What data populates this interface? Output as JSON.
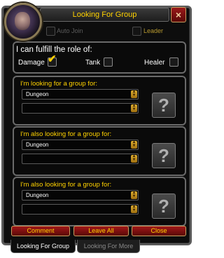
{
  "window": {
    "title": "Looking For Group",
    "close_symbol": "×"
  },
  "options": {
    "auto_join_label": "Auto Join",
    "leader_label": "Leader"
  },
  "roles": {
    "title": "I can fulfill the role of:",
    "damage_label": "Damage",
    "damage_checked": true,
    "tank_label": "Tank",
    "healer_label": "Healer"
  },
  "groups": [
    {
      "label": "I'm looking for a group for:",
      "type_value": "Dungeon",
      "subtype_value": ""
    },
    {
      "label": "I'm also looking for a group for:",
      "type_value": "Dungeon",
      "subtype_value": ""
    },
    {
      "label": "I'm also looking for a group for:",
      "type_value": "Dungeon",
      "subtype_value": ""
    }
  ],
  "question_mark": "?",
  "buttons": {
    "comment": "Comment",
    "leave_all": "Leave All",
    "close": "Close"
  },
  "tabs": [
    {
      "label": "Looking For Group"
    },
    {
      "label": "Looking For More"
    }
  ],
  "colors": {
    "gold": "#ffd200",
    "button_red": "#8a1010",
    "frame_gray": "#5a5a5a"
  }
}
